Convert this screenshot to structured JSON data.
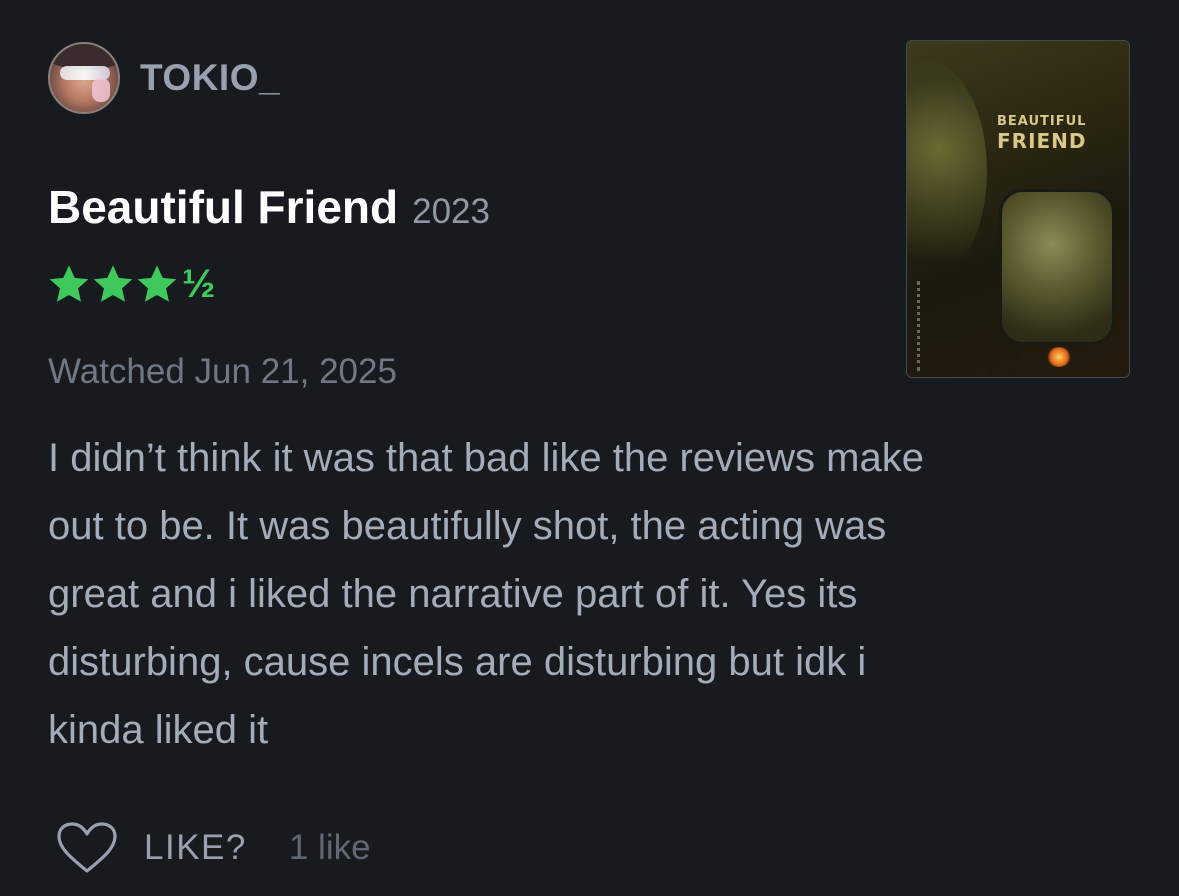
{
  "user": {
    "username": "TOKIO_"
  },
  "film": {
    "title": "Beautiful Friend",
    "year": "2023",
    "poster_title_line1": "BEAUTIFUL",
    "poster_title_line2": "FRIEND"
  },
  "rating": {
    "stars": 3.5,
    "half_glyph": "½",
    "color": "#3fc85c"
  },
  "watched": "Watched Jun 21, 2025",
  "review": {
    "text": "I didn’t think it was that bad like the reviews make\nout to be. It was beautifully shot, the acting was\ngreat and i liked the narrative part of it. Yes its\ndisturbing, cause incels are disturbing but idk i\nkinda liked it"
  },
  "like": {
    "label": "LIKE?",
    "count_text": "1 like",
    "icon": "heart-outline-icon"
  }
}
